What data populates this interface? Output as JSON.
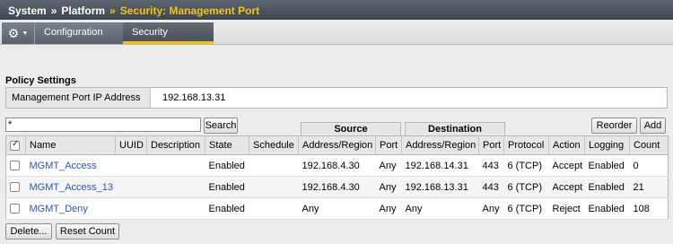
{
  "breadcrumb": {
    "items": [
      "System",
      "Platform"
    ],
    "separator": "»",
    "current": "Security: Management Port"
  },
  "tabs": {
    "gear_icon": "⚙",
    "caret_icon": "▼",
    "configuration": "Configuration",
    "security": "Security"
  },
  "policy": {
    "section_title": "Policy Settings",
    "ip_label": "Management Port IP Address",
    "ip_value": "192.168.13.31"
  },
  "search": {
    "value": "*",
    "button": "Search"
  },
  "actions": {
    "reorder": "Reorder",
    "add": "Add",
    "delete": "Delete...",
    "reset_count": "Reset Count"
  },
  "groups": {
    "source": "Source",
    "destination": "Destination"
  },
  "columns": [
    "Name",
    "UUID",
    "Description",
    "State",
    "Schedule",
    "Address/Region",
    "Port",
    "Address/Region",
    "Port",
    "Protocol",
    "Action",
    "Logging",
    "Count"
  ],
  "rows": [
    {
      "name": "MGMT_Access",
      "uuid": "",
      "description": "",
      "state": "Enabled",
      "schedule": "",
      "src_addr": "192.168.4.30",
      "src_port": "Any",
      "dst_addr": "192.168.14.31",
      "dst_port": "443",
      "protocol": "6 (TCP)",
      "action": "Accept",
      "logging": "Enabled",
      "count": "0"
    },
    {
      "name": "MGMT_Access_13",
      "uuid": "",
      "description": "",
      "state": "Enabled",
      "schedule": "",
      "src_addr": "192.168.4.30",
      "src_port": "Any",
      "dst_addr": "192.168.13.31",
      "dst_port": "443",
      "protocol": "6 (TCP)",
      "action": "Accept",
      "logging": "Enabled",
      "count": "21"
    },
    {
      "name": "MGMT_Deny",
      "uuid": "",
      "description": "",
      "state": "Enabled",
      "schedule": "",
      "src_addr": "Any",
      "src_port": "Any",
      "dst_addr": "Any",
      "dst_port": "Any",
      "protocol": "6 (TCP)",
      "action": "Reject",
      "logging": "Enabled",
      "count": "108"
    }
  ],
  "colors": {
    "accent": "#f2c318",
    "link": "#2458b8"
  }
}
